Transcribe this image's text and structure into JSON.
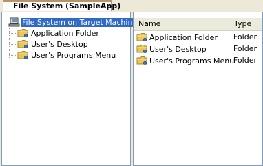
{
  "tab": {
    "title": "File System (SampleApp)"
  },
  "tree": {
    "root": {
      "label": "File System on Target Machine",
      "icon": "computer-icon"
    },
    "children": [
      {
        "label": "Application Folder",
        "icon": "folder-icon"
      },
      {
        "label": "User's Desktop",
        "icon": "folder-icon"
      },
      {
        "label": "User's Programs Menu",
        "icon": "folder-icon"
      }
    ]
  },
  "list": {
    "columns": {
      "name": "Name",
      "type": "Type"
    },
    "rows": [
      {
        "name": "Application Folder",
        "type": "Folder",
        "icon": "folder-icon"
      },
      {
        "name": "User's Desktop",
        "type": "Folder",
        "icon": "folder-icon"
      },
      {
        "name": "User's Programs Menu",
        "type": "Folder",
        "icon": "folder-icon"
      }
    ]
  },
  "colors": {
    "selection": "#316ac5",
    "tab_accent": "#e68b2c",
    "folder": "#e9c75a"
  }
}
